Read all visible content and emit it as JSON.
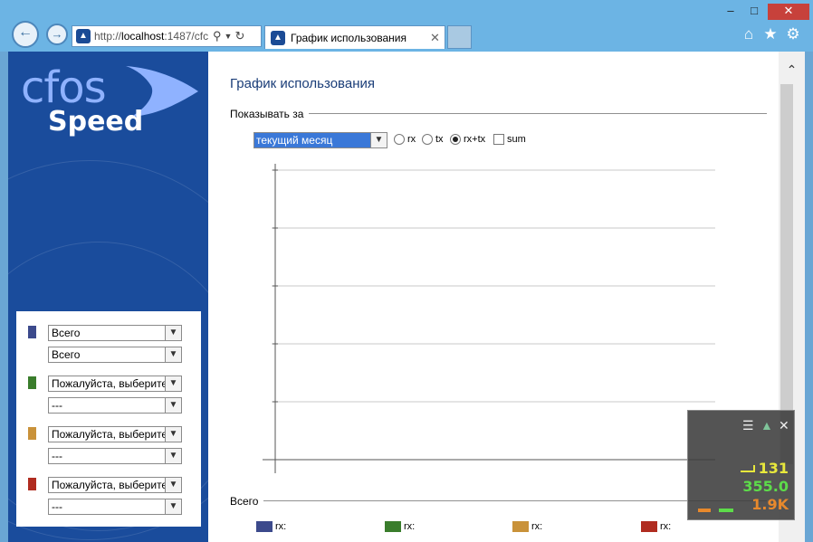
{
  "browser": {
    "address_url_prefix": "http://",
    "address_url_host": "localhost",
    "address_url_rest": ":1487/cfc",
    "tab_title": "График использования",
    "icons": [
      "back-icon",
      "forward-icon",
      "search-icon",
      "dropdown-icon",
      "refresh-icon",
      "close-icon",
      "home-icon",
      "favorites-star-icon",
      "settings-gear-icon",
      "minimize-icon",
      "maximize-icon",
      "window-close-icon"
    ]
  },
  "logo": {
    "line1": "cfos",
    "line2": "Speed"
  },
  "sidebar": {
    "groups": [
      {
        "color": "#3c4a8c",
        "primary": "Всего",
        "secondary": "Всего"
      },
      {
        "color": "#3a7d2c",
        "primary": "Пожалуйста, выберите",
        "secondary": "---"
      },
      {
        "color": "#c9923a",
        "primary": "Пожалуйста, выберите",
        "secondary": "---"
      },
      {
        "color": "#b02c20",
        "primary": "Пожалуйста, выберите",
        "secondary": "---"
      }
    ]
  },
  "main": {
    "title": "График использования",
    "show_for_label": "Показывать за",
    "period_value": "текущий месяц",
    "options": {
      "rx": "rx",
      "tx": "tx",
      "rxtx": "rx+tx",
      "sum": "sum"
    },
    "selected_option": "rx+tx",
    "totals_label": "Всего",
    "legend": [
      {
        "color": "#3c4a8c",
        "label": "rx:"
      },
      {
        "color": "#3a7d2c",
        "label": "rx:"
      },
      {
        "color": "#c9923a",
        "label": "rx:"
      },
      {
        "color": "#b02c20",
        "label": "rx:"
      }
    ]
  },
  "chart_data": {
    "type": "line",
    "title": "",
    "xlabel": "",
    "ylabel": "",
    "series": [],
    "grid": true
  },
  "widget": {
    "ping": "131",
    "upload": "355.0",
    "download": "1.9K",
    "colors": {
      "ping": "#e8e83c",
      "upload": "#5ddc4a",
      "download": "#e8892c"
    }
  }
}
